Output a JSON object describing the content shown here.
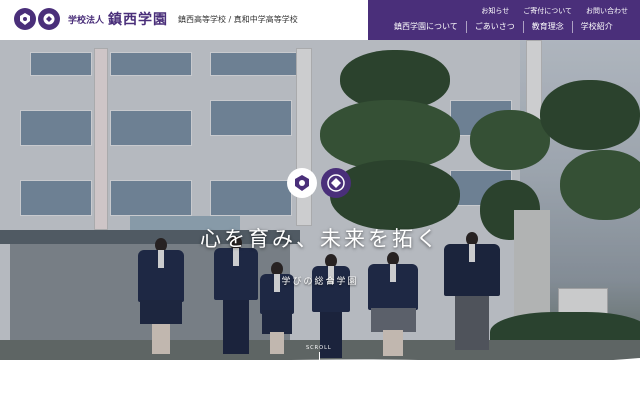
{
  "header": {
    "corp_label": "学校法人",
    "school_name": "鎮西学園",
    "sub_schools": "鎮西高等学校 / 真和中学高等学校",
    "util_links": [
      "お知らせ",
      "ご寄付について",
      "お問い合わせ"
    ],
    "nav_items": [
      "鎮西学園について",
      "ごあいさつ",
      "教育理念",
      "学校紹介"
    ],
    "brand_color": "#4a2f7a"
  },
  "hero": {
    "catchcopy": "心を育み、未来を拓く",
    "subcopy": "学びの総合学園",
    "scroll_label": "SCROLL",
    "emblem_icons": [
      "school-crest-icon",
      "school-crest-icon"
    ]
  }
}
